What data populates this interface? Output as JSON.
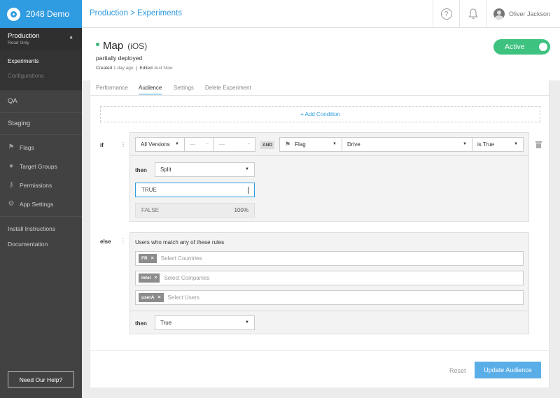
{
  "app": {
    "name": "2048 Demo",
    "brand_color": "#2f9be0"
  },
  "environment": {
    "name": "Production",
    "subtitle": "Read Only"
  },
  "env_menu": [
    {
      "label": "Experiments",
      "active": true
    },
    {
      "label": "Configurations",
      "active": false
    }
  ],
  "sidebar": {
    "sections": [
      "QA",
      "Staging"
    ],
    "tools": [
      {
        "label": "Flags",
        "icon": "flag-icon"
      },
      {
        "label": "Target Groups",
        "icon": "users-icon"
      },
      {
        "label": "Permissions",
        "icon": "key-icon"
      },
      {
        "label": "App Settings",
        "icon": "gear-icon"
      }
    ],
    "links": [
      "Install Instructions",
      "Documentation"
    ],
    "help_button": "Need Our Help?"
  },
  "topbar": {
    "breadcrumb": "Production > Experiments",
    "user_name": "Oliver Jackson"
  },
  "experiment": {
    "name": "Map",
    "platform": "(iOS)",
    "status": "partially deployed",
    "created_label": "Created",
    "created_value": "1 day ago",
    "edited_label": "Edited",
    "edited_value": "Just Now",
    "toggle_label": "Active",
    "toggle_color": "#3ec27f"
  },
  "tabs": [
    "Performance",
    "Audience",
    "Settings",
    "Delete Experiment"
  ],
  "active_tab": "Audience",
  "audience": {
    "add_condition": "+ Add Condition",
    "if_label": "if",
    "if_rule": {
      "version_select": "All Versions",
      "from_select": "—",
      "to_select": "—",
      "and_label": "AND",
      "type_select": "Flag",
      "flag_select": "Drive",
      "condition_select": "is True",
      "then_label": "then",
      "then_select": "Split",
      "split_rows": [
        {
          "label": "TRUE",
          "value": ""
        },
        {
          "label": "FALSE",
          "value": "100%"
        }
      ]
    },
    "else_label": "else",
    "else_rule": {
      "header": "Users who match any of these rules",
      "rows": [
        {
          "chip": "FR",
          "placeholder": "Select Countries"
        },
        {
          "chip": "Intel",
          "placeholder": "Select Companies"
        },
        {
          "chip": "userA",
          "placeholder": "Select Users"
        }
      ],
      "then_label": "then",
      "then_select": "True"
    }
  },
  "footer": {
    "reset_label": "Reset",
    "update_label": "Update Audience"
  }
}
